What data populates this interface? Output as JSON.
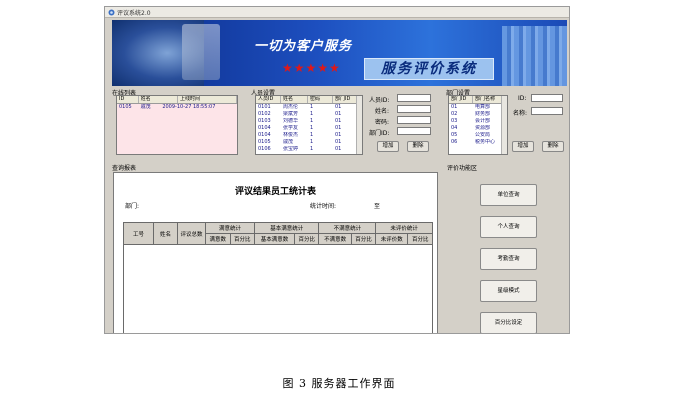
{
  "window": {
    "title": "评议系统2.0"
  },
  "banner": {
    "slogan": "一切为客户服务",
    "stars": "★★★★★",
    "system_name": "服务评价系统"
  },
  "online": {
    "section_label": "在线列表",
    "columns": [
      "ID",
      "姓名",
      "上线时间"
    ],
    "rows": [
      [
        "0105",
        "戚茂",
        "2009-10-27 18:55:07"
      ]
    ]
  },
  "staff": {
    "section_label": "人员设置",
    "columns": [
      "人员ID",
      "姓名",
      "密码",
      "部门ID"
    ],
    "rows": [
      [
        "0101",
        "周杰伦",
        "1",
        "01"
      ],
      [
        "0102",
        "梁斌芳",
        "1",
        "01"
      ],
      [
        "0103",
        "刘德华",
        "1",
        "01"
      ],
      [
        "0104",
        "张学友",
        "1",
        "01"
      ],
      [
        "0104",
        "林俊杰",
        "1",
        "01"
      ],
      [
        "0105",
        "戚茂",
        "1",
        "01"
      ],
      [
        "0106",
        "张宝婷",
        "1",
        "01"
      ]
    ],
    "field_labels": [
      "人员ID:",
      "姓名:",
      "密码:",
      "部门ID:"
    ],
    "add_label": "增加",
    "delete_label": "删除"
  },
  "dept": {
    "section_label": "部门设置",
    "columns": [
      "部门ID",
      "部门名称"
    ],
    "rows": [
      [
        "01",
        "电算部"
      ],
      [
        "02",
        "财务部"
      ],
      [
        "03",
        "会计部"
      ],
      [
        "04",
        "资源部"
      ],
      [
        "05",
        "公安局"
      ],
      [
        "06",
        "税务中心"
      ]
    ],
    "field_labels": [
      "ID:",
      "名称:"
    ],
    "add_label": "增加",
    "delete_label": "删除"
  },
  "report": {
    "section_label": "查询报表",
    "title": "评议结果员工统计表",
    "dept_label": "部门:",
    "period_label": "统计时间:",
    "to_label": "至",
    "headers_top": [
      "工号",
      "姓名",
      "评议总数",
      "满意统计",
      "基本满意统计",
      "不满意统计",
      "未评价统计"
    ],
    "headers_sub": [
      "满意数",
      "百分比",
      "基本满意数",
      "百分比",
      "不满意数",
      "百分比",
      "未评价数",
      "百分比"
    ]
  },
  "functions": {
    "section_label": "评价功能区",
    "buttons": [
      "单位查询",
      "个人查询",
      "考勤查询",
      "星级模式",
      "百分比设定"
    ]
  },
  "caption": "图 3 服务器工作界面"
}
